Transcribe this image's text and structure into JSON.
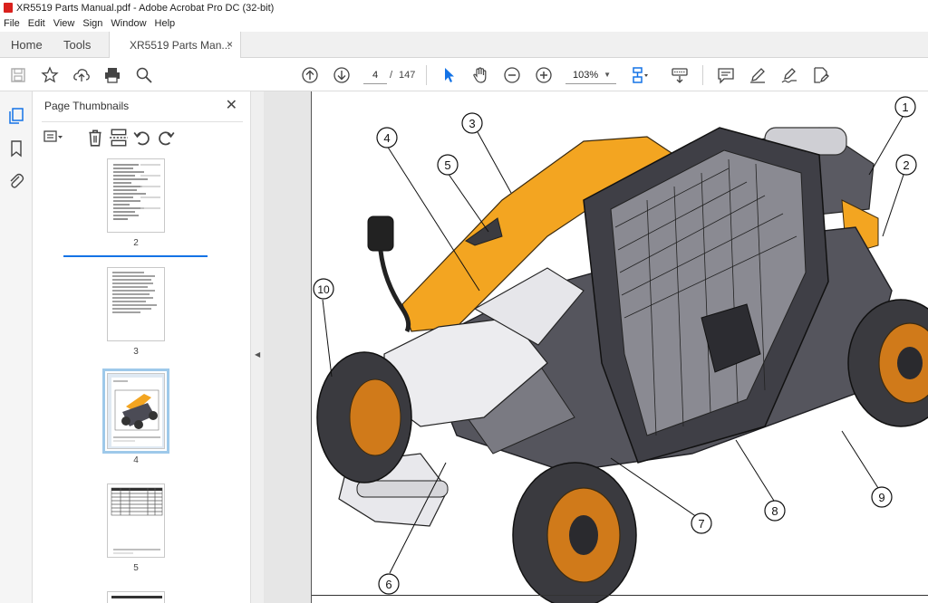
{
  "window": {
    "title": "XR5519 Parts Manual.pdf - Adobe Acrobat Pro DC (32-bit)"
  },
  "menu": [
    "File",
    "Edit",
    "View",
    "Sign",
    "Window",
    "Help"
  ],
  "tabs": {
    "home": "Home",
    "tools": "Tools",
    "doc": "XR5519 Parts Man...",
    "close": "×"
  },
  "toolbar": {
    "page_current": "4",
    "page_sep": "/",
    "page_total": "147",
    "zoom": "103%"
  },
  "panel": {
    "title": "Page Thumbnails",
    "close": "✕",
    "thumbnails": [
      {
        "label": "2"
      },
      {
        "label": "3"
      },
      {
        "label": "4",
        "selected": true
      },
      {
        "label": "5"
      }
    ]
  },
  "diagram": {
    "callouts": [
      "1",
      "2",
      "3",
      "4",
      "5",
      "6",
      "7",
      "8",
      "9",
      "10"
    ]
  },
  "colors": {
    "accent": "#1473e6",
    "machine_orange": "#f3a521",
    "rim_orange": "#e08a1e"
  }
}
